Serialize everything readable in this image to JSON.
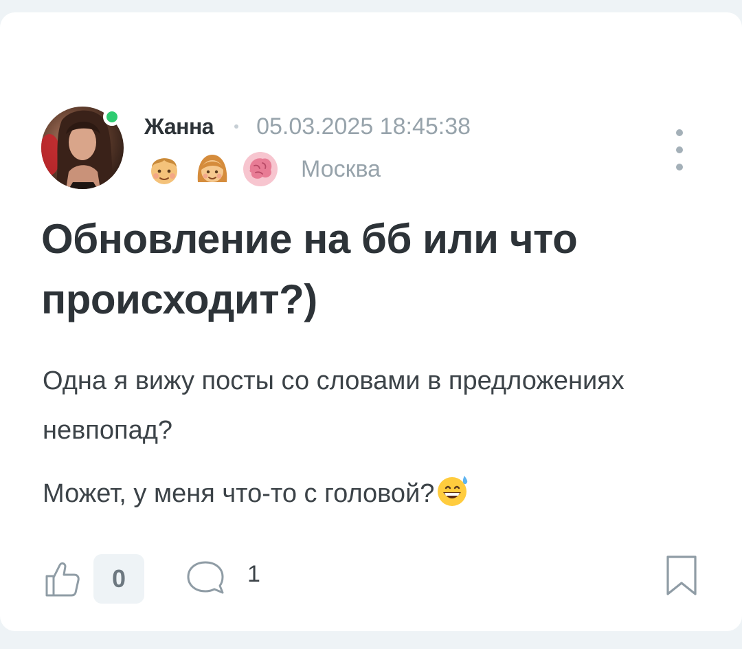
{
  "post": {
    "author": {
      "name": "Жанна",
      "online": true,
      "avatar": "avatar-photo"
    },
    "date": "05.03.2025 18:45:38",
    "badges": [
      "boy-face-emoji-icon",
      "girl-face-emoji-icon",
      "brain-emoji-icon"
    ],
    "location": "Москва",
    "title": "Обновление на бб или что происходит?)",
    "body": {
      "paragraph_1": "Одна я вижу посты со словами в предложениях невпопад?",
      "paragraph_2": "Может, у меня что-то с головой?",
      "paragraph_2_emoji": "grinning-sweat-emoji"
    },
    "actions": {
      "like_count": "0",
      "comment_count": "1"
    }
  },
  "colors": {
    "page_background": "#eef3f6",
    "card_background": "#ffffff",
    "online_indicator": "#2ecc71",
    "title_text": "#2d3338",
    "meta_text": "#97a3ab",
    "icon_color": "#8f9ca5"
  }
}
